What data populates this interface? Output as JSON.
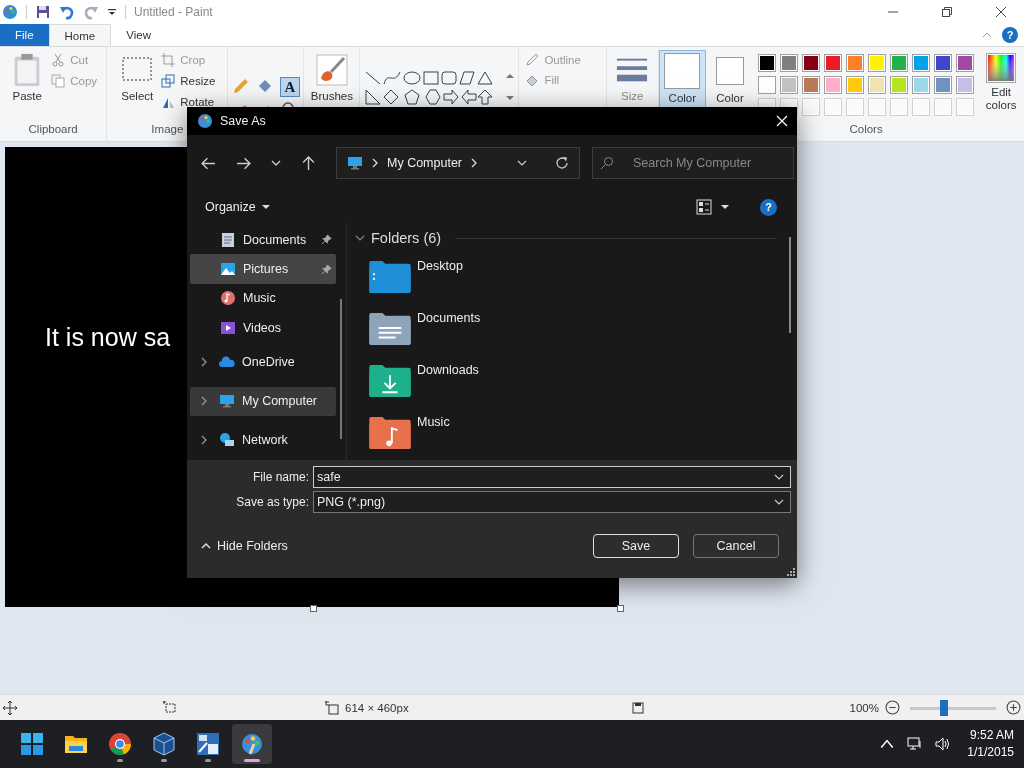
{
  "window": {
    "title": "Untitled - Paint"
  },
  "ribbon_tabs": [
    {
      "label": "File",
      "kind": "file",
      "selected": false
    },
    {
      "label": "Home",
      "kind": "tab",
      "selected": true
    },
    {
      "label": "View",
      "kind": "tab",
      "selected": false
    }
  ],
  "clipboard": {
    "paste": "Paste",
    "cut": "Cut",
    "copy": "Copy",
    "label": "Clipboard"
  },
  "image": {
    "select": "Select",
    "crop": "Crop",
    "resize": "Resize",
    "rotate": "Rotate",
    "label": "Image"
  },
  "text_tool": "A",
  "help_icon": "?",
  "brushes": "Brushes",
  "shape_style": {
    "outline": "Outline",
    "fill": "Fill"
  },
  "size": "Size",
  "color_1": {
    "label": "Color",
    "selected": true
  },
  "color_2": {
    "label": "Color",
    "selected": false
  },
  "palette": [
    {
      "color": "#000000"
    },
    {
      "color": "#7f7f7f"
    },
    {
      "color": "#880015"
    },
    {
      "color": "#ed1c24"
    },
    {
      "color": "#ff7f27"
    },
    {
      "color": "#fff200"
    },
    {
      "color": "#22b14c"
    },
    {
      "color": "#00a2e8"
    },
    {
      "color": "#3f48cc"
    },
    {
      "color": "#a349a4"
    },
    {
      "color": "#ffffff"
    },
    {
      "color": "#c3c3c3"
    },
    {
      "color": "#b97a57"
    },
    {
      "color": "#ffaec9"
    },
    {
      "color": "#ffc90e"
    },
    {
      "color": "#efe4b0"
    },
    {
      "color": "#b5e61d"
    },
    {
      "color": "#99d9ea"
    },
    {
      "color": "#7092be"
    },
    {
      "color": "#c8bfe7"
    }
  ],
  "colors_label": "Colors",
  "edit_colors": "Edit colors",
  "canvas": {
    "text": "It is now sa"
  },
  "dialog": {
    "title": "Save As",
    "address": "My Computer",
    "search": {
      "placeholder": "Search My Computer"
    },
    "organize": "Organize",
    "help_icon": "?",
    "sidebar": [
      {
        "label": "Documents",
        "kind": "documents",
        "expandable": false,
        "pinned": true,
        "selected": false
      },
      {
        "label": "Pictures",
        "kind": "pictures",
        "expandable": false,
        "pinned": true,
        "selected": true
      },
      {
        "label": "Music",
        "kind": "music",
        "expandable": false,
        "pinned": false,
        "selected": false
      },
      {
        "label": "Videos",
        "kind": "videos",
        "expandable": false,
        "pinned": false,
        "selected": false
      },
      {
        "label": "OneDrive",
        "kind": "cloud",
        "expandable": true,
        "pinned": false,
        "selected": false
      },
      {
        "label": "My Computer",
        "kind": "computer",
        "expandable": true,
        "pinned": false,
        "selected": true
      },
      {
        "label": "Network",
        "kind": "network",
        "expandable": true,
        "pinned": false,
        "selected": false
      }
    ],
    "section": "Folders (6)",
    "folders": [
      {
        "name": "Desktop",
        "kind": "desktop",
        "color": "#1e8fd8"
      },
      {
        "name": "Documents",
        "kind": "documents",
        "color": "#8fa3bb"
      },
      {
        "name": "Downloads",
        "kind": "downloads",
        "color": "#1fb08c"
      },
      {
        "name": "Music",
        "kind": "music",
        "color": "#e8704c"
      }
    ],
    "file_name": {
      "label": "File name:",
      "value": "safe"
    },
    "save_as_type": {
      "label": "Save as type:",
      "value": "PNG (*.png)"
    },
    "hide_folders": "Hide Folders",
    "buttons": [
      "Save",
      "Cancel"
    ]
  },
  "status_bar": {
    "dimensions": "614 × 460px",
    "zoom": "100%",
    "zoom_slider": {
      "level": 0.4
    }
  },
  "taskbar": {
    "apps": [
      {
        "kind": "start",
        "selected": false
      },
      {
        "kind": "explorer",
        "selected": false
      },
      {
        "kind": "chrome",
        "selected": false
      },
      {
        "kind": "cube",
        "selected": false
      },
      {
        "kind": "calculator",
        "selected": false
      },
      {
        "kind": "paint",
        "selected": true
      }
    ],
    "time": "9:52 AM",
    "date": "1/1/2015"
  }
}
